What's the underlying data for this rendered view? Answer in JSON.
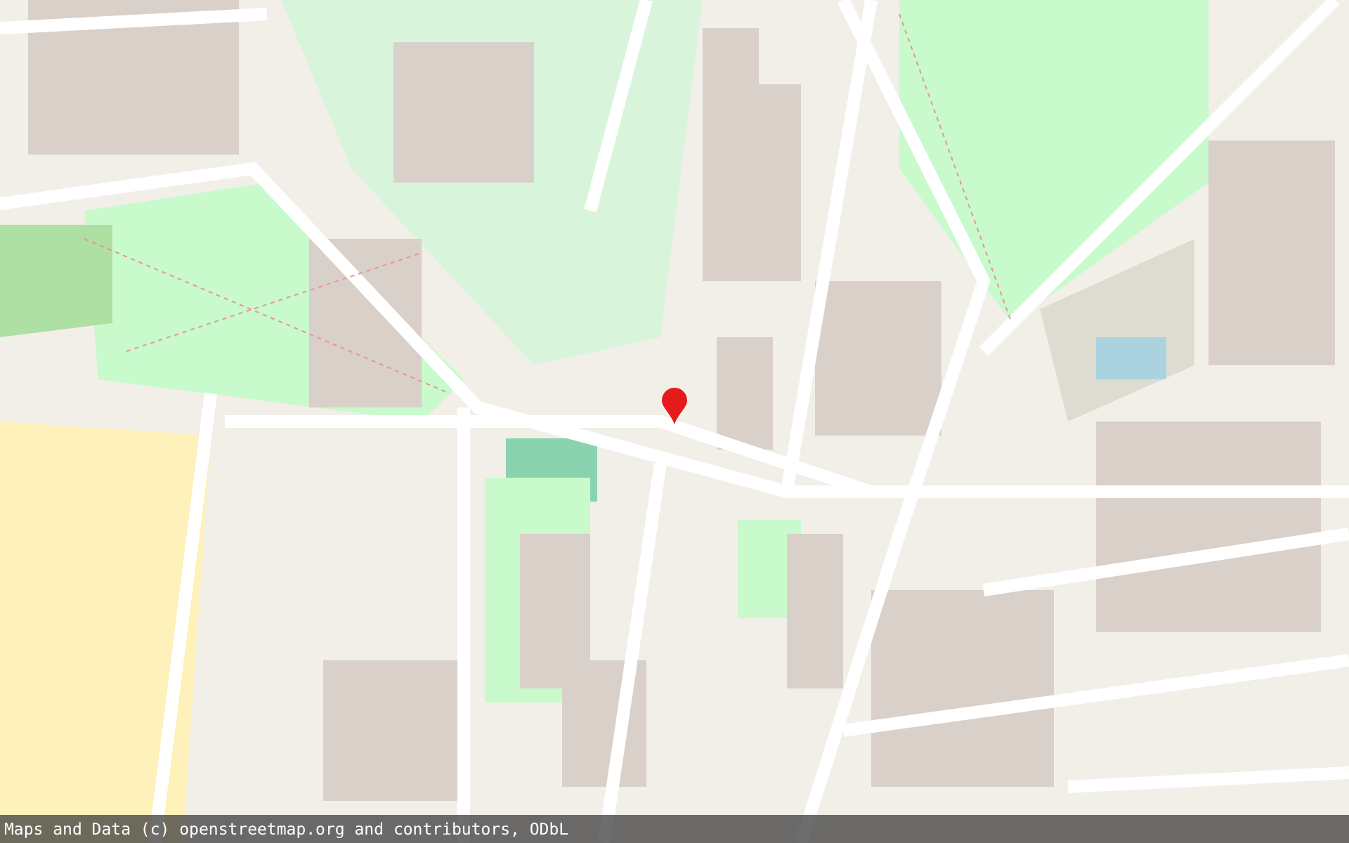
{
  "map": {
    "marker": {
      "shown": true
    }
  },
  "attribution": "Maps and Data (c) openstreetmap.org and contributors, ODbL"
}
